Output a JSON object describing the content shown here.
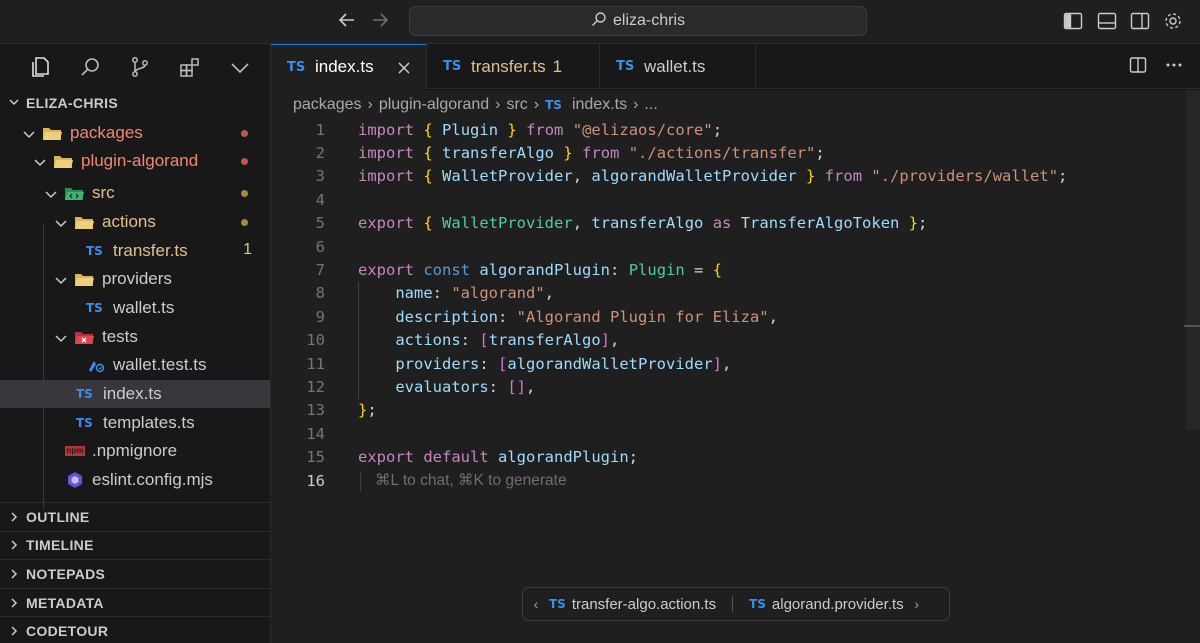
{
  "titlebar": {
    "search_text": "eliza-chris"
  },
  "sidebar": {
    "explorer_title": "ELIZA-CHRIS",
    "tree": [
      {
        "label": "packages",
        "kind": "folder",
        "status": "err"
      },
      {
        "label": "plugin-algorand",
        "kind": "folder",
        "status": "err"
      },
      {
        "label": "src",
        "kind": "folder-src",
        "status": "mod"
      },
      {
        "label": "actions",
        "kind": "folder",
        "status": "mod"
      },
      {
        "label": "transfer.ts",
        "kind": "ts",
        "status": "mod",
        "count": "1"
      },
      {
        "label": "providers",
        "kind": "folder",
        "status": ""
      },
      {
        "label": "wallet.ts",
        "kind": "ts",
        "status": ""
      },
      {
        "label": "tests",
        "kind": "folder-test",
        "status": ""
      },
      {
        "label": "wallet.test.ts",
        "kind": "test",
        "status": ""
      },
      {
        "label": "index.ts",
        "kind": "ts",
        "status": ""
      },
      {
        "label": "templates.ts",
        "kind": "ts",
        "status": ""
      },
      {
        "label": ".npmignore",
        "kind": "npm",
        "status": ""
      },
      {
        "label": "eslint.config.mjs",
        "kind": "eslint",
        "status": ""
      }
    ],
    "npm_badge": "npm",
    "panes": [
      "OUTLINE",
      "TIMELINE",
      "NOTEPADS",
      "METADATA",
      "CODETOUR"
    ]
  },
  "tabs": [
    {
      "label": "index.ts",
      "badge": "TS",
      "count": ""
    },
    {
      "label": "transfer.ts",
      "badge": "TS",
      "count": "1"
    },
    {
      "label": "wallet.ts",
      "badge": "TS",
      "count": ""
    }
  ],
  "breadcrumb": {
    "parts": [
      "packages",
      "plugin-algorand",
      "src"
    ],
    "badge": "TS",
    "file": "index.ts",
    "more": "..."
  },
  "code": {
    "line_numbers": [
      "1",
      "2",
      "3",
      "4",
      "5",
      "6",
      "7",
      "8",
      "9",
      "10",
      "11",
      "12",
      "13",
      "14",
      "15",
      "16"
    ],
    "hint": "⌘L to chat, ⌘K to generate"
  },
  "related": {
    "items": [
      {
        "badge": "TS",
        "label": "transfer-algo.action.ts"
      },
      {
        "badge": "TS",
        "label": "algorand.provider.ts"
      }
    ]
  },
  "colors": {
    "accent": "#0078d4",
    "ts_badge": "#3b8eea",
    "modified": "#e2c08d",
    "error": "#f48771"
  }
}
